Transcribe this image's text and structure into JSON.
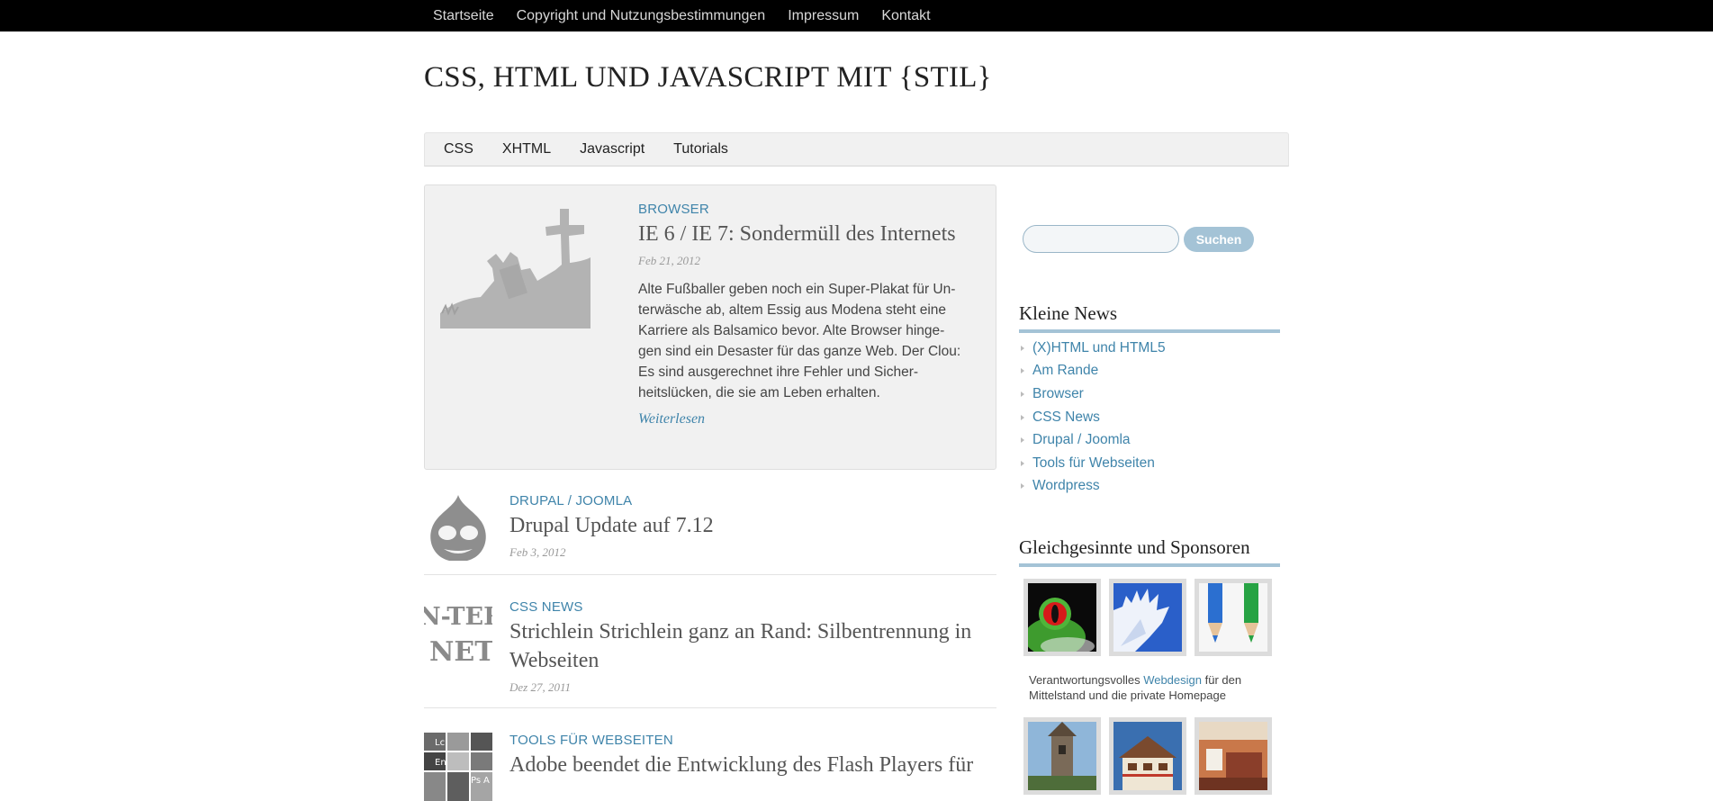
{
  "topnav": {
    "items": [
      "Startseite",
      "Copyright und Nutzungsbestimmungen",
      "Impressum",
      "Kontakt"
    ]
  },
  "site": {
    "title": "CSS, HTML UND JAVASCRIPT MIT {STIL}"
  },
  "mainnav": {
    "items": [
      "CSS",
      "XHTML",
      "Javascript",
      "Tutorials"
    ]
  },
  "featured": {
    "category": "BROWSER",
    "title": "IE 6 / IE 7: Sondermüll des Internets",
    "date": "Feb 21, 2012",
    "excerpt": "Alte Fußballer geben noch ein Super-Plakat für Un­terwäsche ab, altem Essig aus Modena steht eine Karriere als Balsamico bevor. Alte Browser hinge­gen sind ein Desaster für das ganze Web. Der Clou: Es sind ausgerechnet ihre Fehler und Sicher­heitslücken, die sie am Leben erhalten.",
    "more": "Weiterlesen"
  },
  "posts": [
    {
      "category": "DRUPAL / JOOMLA",
      "title": "Drupal Update auf 7.12",
      "date": "Feb 3, 2012"
    },
    {
      "category": "CSS NEWS",
      "title": "Strichlein Strichlein ganz an Rand: Silbentrennung in Webseiten",
      "date": "Dez 27, 2011",
      "thumb_text_1": "N-TER",
      "thumb_text_2": "NET"
    },
    {
      "category": "TOOLS FÜR WEBSEITEN",
      "title": "Adobe beendet die Entwicklung des Flash Players für",
      "thumb_labels": [
        "Lc",
        "En",
        "Ps",
        "A"
      ]
    }
  ],
  "search": {
    "placeholder": "",
    "button": "Suchen"
  },
  "news": {
    "heading": "Kleine News",
    "items": [
      "(X)HTML und HTML5",
      "Am Rande",
      "Browser",
      "CSS News",
      "Drupal / Joomla",
      "Tools für Webseiten",
      "Wordpress"
    ]
  },
  "sponsors": {
    "heading": "Gleichgesinnte und Sponsoren",
    "text_before": "Verantwortungsvolles ",
    "link": "Webdesign",
    "text_after": " für den Mittelstand und die private Homepage"
  },
  "colors": {
    "accent": "#3f84aa",
    "topbar": "#000000",
    "sidebar_rule": "#a4c3d6",
    "panel": "#f1f1f1"
  }
}
